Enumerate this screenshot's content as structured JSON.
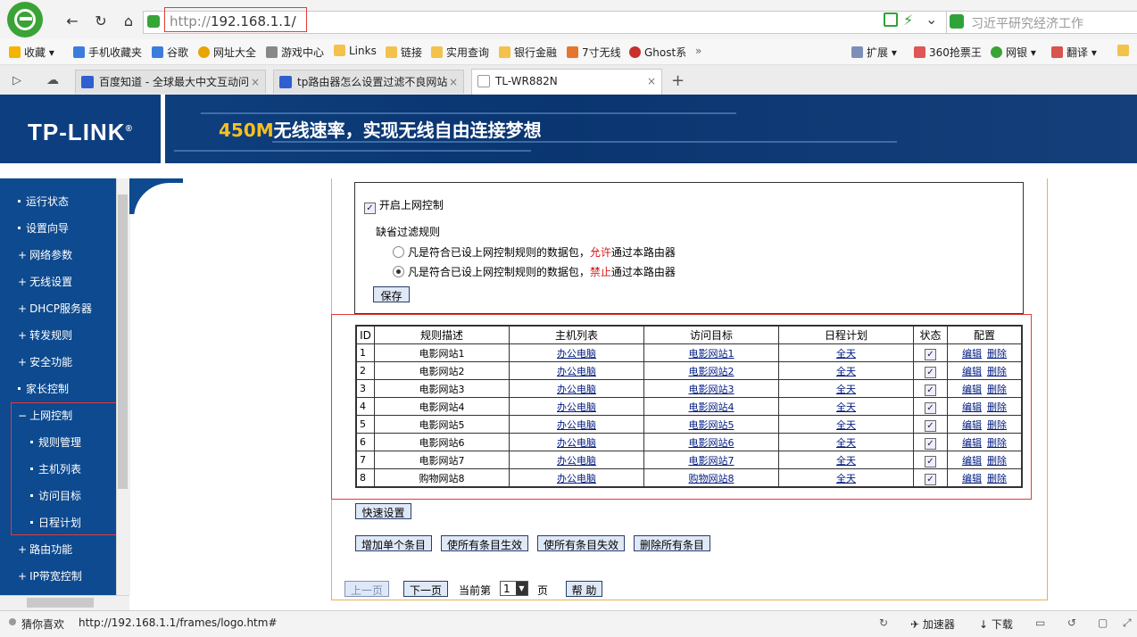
{
  "browser": {
    "url_proto": "http://",
    "url_host": "192.168.1.1/",
    "search_placeholder": "习近平研究经济工作",
    "bookmarks": [
      "收藏",
      "手机收藏夹",
      "谷歌",
      "网址大全",
      "游戏中心",
      "Links",
      "链接",
      "实用查询",
      "银行金融",
      "7寸无线",
      "Ghost系",
      "»"
    ],
    "bookmarks_right": [
      "扩展",
      "360抢票王",
      "网银",
      "翻译"
    ],
    "tabs": [
      "百度知道 - 全球最大中文互动问",
      "tp路由器怎么设置过滤不良网站",
      "TL-WR882N"
    ],
    "status_left": "猜你喜欢",
    "status_url": "http://192.168.1.1/frames/logo.htm#",
    "status_right": [
      "加速器",
      "下载"
    ]
  },
  "banner": {
    "brand": "TP-LINK",
    "registered": "®",
    "slogan_highlight": "450M",
    "slogan_rest": "无线速率，实现无线自由连接梦想"
  },
  "sidebar": {
    "items": [
      "运行状态",
      "设置向导",
      "网络参数",
      "无线设置",
      "DHCP服务器",
      "转发规则",
      "安全功能",
      "家长控制",
      "上网控制",
      "规则管理",
      "主机列表",
      "访问目标",
      "日程计划",
      "路由功能",
      "IP带宽控制"
    ]
  },
  "control": {
    "enable_label": "开启上网控制",
    "default_rule_title": "缺省过滤规则",
    "rule_allow_pre": "凡是符合已设上网控制规则的数据包，",
    "rule_allow_word": "允许",
    "rule_allow_post": "通过本路由器",
    "rule_deny_pre": "凡是符合已设上网控制规则的数据包，",
    "rule_deny_word": "禁止",
    "rule_deny_post": "通过本路由器",
    "save_label": "保存"
  },
  "table": {
    "headers": [
      "ID",
      "规则描述",
      "主机列表",
      "访问目标",
      "日程计划",
      "状态",
      "配置"
    ],
    "rows": [
      {
        "id": "1",
        "desc": "电影网站1",
        "host": "办公电脑",
        "target": "电影网站1",
        "schedule": "全天",
        "edit": "编辑",
        "delete": "删除"
      },
      {
        "id": "2",
        "desc": "电影网站2",
        "host": "办公电脑",
        "target": "电影网站2",
        "schedule": "全天",
        "edit": "编辑",
        "delete": "删除"
      },
      {
        "id": "3",
        "desc": "电影网站3",
        "host": "办公电脑",
        "target": "电影网站3",
        "schedule": "全天",
        "edit": "编辑",
        "delete": "删除"
      },
      {
        "id": "4",
        "desc": "电影网站4",
        "host": "办公电脑",
        "target": "电影网站4",
        "schedule": "全天",
        "edit": "编辑",
        "delete": "删除"
      },
      {
        "id": "5",
        "desc": "电影网站5",
        "host": "办公电脑",
        "target": "电影网站5",
        "schedule": "全天",
        "edit": "编辑",
        "delete": "删除"
      },
      {
        "id": "6",
        "desc": "电影网站6",
        "host": "办公电脑",
        "target": "电影网站6",
        "schedule": "全天",
        "edit": "编辑",
        "delete": "删除"
      },
      {
        "id": "7",
        "desc": "电影网站7",
        "host": "办公电脑",
        "target": "电影网站7",
        "schedule": "全天",
        "edit": "编辑",
        "delete": "删除"
      },
      {
        "id": "8",
        "desc": "购物网站8",
        "host": "办公电脑",
        "target": "购物网站8",
        "schedule": "全天",
        "edit": "编辑",
        "delete": "删除"
      }
    ]
  },
  "actions": {
    "quick_setup": "快速设置",
    "add_entry": "增加单个条目",
    "enable_all": "使所有条目生效",
    "disable_all": "使所有条目失效",
    "delete_all": "删除所有条目"
  },
  "pager": {
    "prev": "上一页",
    "next": "下一页",
    "current_label": "当前第",
    "page_value": "1",
    "page_suffix": "页",
    "help": "帮 助"
  },
  "colors": {
    "brand_blue": "#0d4a8f",
    "highlight_red": "#e23b3b",
    "link_blue": "#001a80"
  }
}
